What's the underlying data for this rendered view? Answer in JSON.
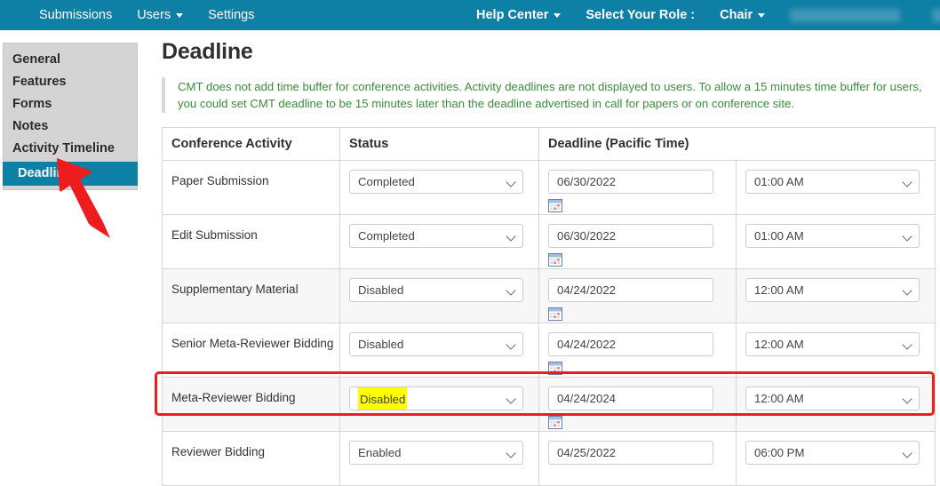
{
  "topbar": {
    "left_items": [
      {
        "label": "Submissions",
        "caret": false
      },
      {
        "label": "Users",
        "caret": true
      },
      {
        "label": "Settings",
        "caret": false
      }
    ],
    "right_items": [
      {
        "label": "Help Center",
        "caret": true
      },
      {
        "label": "Select Your Role :",
        "caret": false
      },
      {
        "label": "Chair",
        "caret": true
      }
    ],
    "redacted_user": "",
    "redacted_action": "",
    "background_color": "#0e7fa5"
  },
  "sidebar": {
    "items": [
      {
        "label": "General",
        "active": false
      },
      {
        "label": "Features",
        "active": false
      },
      {
        "label": "Forms",
        "active": false
      },
      {
        "label": "Notes",
        "active": false
      },
      {
        "label": "Activity Timeline",
        "active": false
      },
      {
        "label": "Deadline",
        "active": true
      }
    ],
    "active_color": "#0e7fa5",
    "background_color": "#d4d4d4"
  },
  "main": {
    "page_title": "Deadline",
    "notice": "CMT does not add time buffer for conference activities. Activity deadlines are not displayed to users. To allow a 15 minutes time buffer for users, you could set CMT deadline to be 15 minutes later than the deadline advertised in call for papers or on conference site.",
    "notice_color": "#3b8c3b",
    "table": {
      "headers": [
        "Conference Activity",
        "Status",
        "Deadline (Pacific Time)"
      ],
      "rows": [
        {
          "activity": "Paper Submission",
          "status": "Completed",
          "date": "06/30/2022",
          "time": "01:00 AM",
          "striped": false,
          "highlighted": false,
          "status_highlighted": false
        },
        {
          "activity": "Edit Submission",
          "status": "Completed",
          "date": "06/30/2022",
          "time": "01:00 AM",
          "striped": false,
          "highlighted": false,
          "status_highlighted": false
        },
        {
          "activity": "Supplementary Material",
          "status": "Disabled",
          "date": "04/24/2022",
          "time": "12:00 AM",
          "striped": true,
          "highlighted": false,
          "status_highlighted": false
        },
        {
          "activity": "Senior Meta-Reviewer Bidding",
          "status": "Disabled",
          "date": "04/24/2022",
          "time": "12:00 AM",
          "striped": false,
          "highlighted": false,
          "status_highlighted": false
        },
        {
          "activity": "Meta-Reviewer Bidding",
          "status": "Disabled",
          "date": "04/24/2024",
          "time": "12:00 AM",
          "striped": true,
          "highlighted": true,
          "status_highlighted": true
        },
        {
          "activity": "Reviewer Bidding",
          "status": "Enabled",
          "date": "04/25/2022",
          "time": "06:00 PM",
          "striped": false,
          "highlighted": false,
          "status_highlighted": false
        }
      ]
    }
  },
  "annotations": {
    "arrow_color": "#ee1c1c",
    "highlight_box_color": "#ee1c1c",
    "status_highlight_color": "#ffff00"
  },
  "icons": {
    "calendar": "calendar-icon",
    "chevron_down": "chevron-down-icon"
  }
}
